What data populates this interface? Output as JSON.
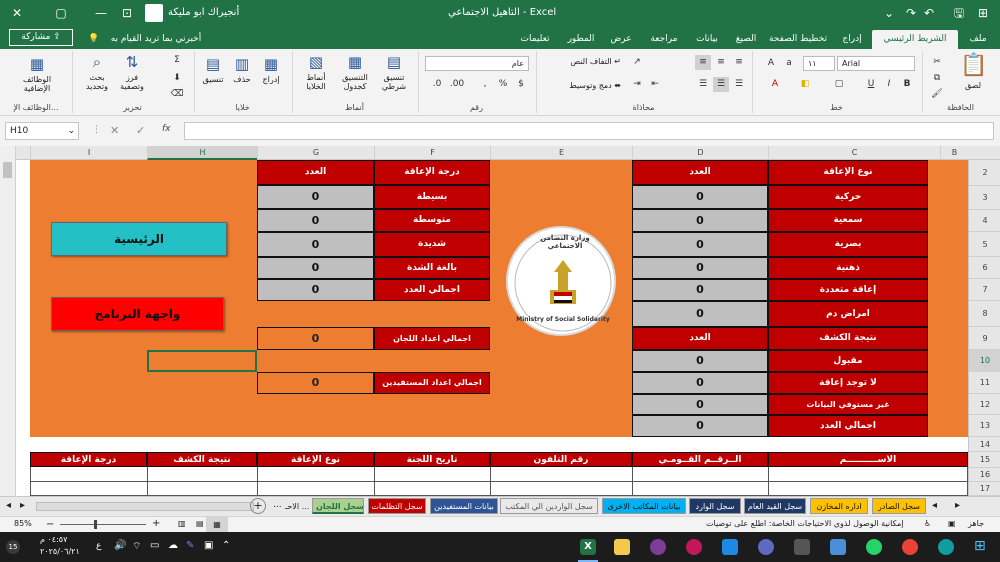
{
  "window": {
    "title": "التاهيل الاجتماعي  -  Excel",
    "user": "أنجيراك ابو مليكة",
    "search_hint": "أخبرني بما تريد القيام به"
  },
  "ribbon_tabs": [
    "ملف",
    "الشريط الرئيسي",
    "إدراج",
    "تخطيط الصفحة",
    "الصيغ",
    "بيانات",
    "مراجعة",
    "عرض",
    "المطور",
    "تعليمات"
  ],
  "share_label": "مشاركة",
  "ribbon": {
    "clipboard": {
      "label": "الحافظة",
      "paste": "لصق"
    },
    "font": {
      "label": "خط",
      "name": "Arial",
      "size": "١١"
    },
    "alignment": {
      "label": "محاذاة",
      "wrap": "التفاف النص",
      "merge": "دمج وتوسيط"
    },
    "number": {
      "label": "رقم",
      "format": "عام"
    },
    "styles": {
      "label": "أنماط",
      "conditional": "تنسيق شرطي",
      "table": "التنسيق كجدول",
      "cell": "أنماط الخلايا"
    },
    "cells": {
      "label": "خلايا",
      "insert": "إدراج",
      "delete": "حذف",
      "format": "تنسيق"
    },
    "editing": {
      "label": "تحرير",
      "sort": "فرز وتصفية",
      "find": "بحث وتحديد"
    },
    "addins": {
      "label": "الوظائف الإ...",
      "btn": "الوظائف الإضافية"
    }
  },
  "formula_bar": {
    "name_box": "H10",
    "fx": "fx"
  },
  "columns": [
    "A",
    "B",
    "C",
    "D",
    "E",
    "F",
    "G",
    "H",
    "I"
  ],
  "rows": [
    "1",
    "2",
    "3",
    "4",
    "5",
    "6",
    "7",
    "8",
    "9",
    "10",
    "11",
    "12",
    "13",
    "14",
    "15",
    "16",
    "17"
  ],
  "disability_type": {
    "header": "نوع الإعاقة",
    "count_header": "العدد",
    "items": [
      {
        "label": "حركية",
        "value": "0"
      },
      {
        "label": "سمعية",
        "value": "0"
      },
      {
        "label": "بصرية",
        "value": "0"
      },
      {
        "label": "ذهنية",
        "value": "0"
      },
      {
        "label": "إعاقة متعددة",
        "value": "0"
      },
      {
        "label": "امراض دم",
        "value": "0"
      }
    ]
  },
  "exam_result": {
    "header": "نتيجة الكشف",
    "count_header": "العدد",
    "items": [
      {
        "label": "مقبول",
        "value": "0"
      },
      {
        "label": "لا توجد إعاقة",
        "value": "0"
      },
      {
        "label": "غير مستوفي البيانات",
        "value": "0"
      },
      {
        "label": "اجمالي العدد",
        "value": "0"
      }
    ]
  },
  "degree": {
    "header": "درجة الإعاقة",
    "count_header": "العدد",
    "items": [
      {
        "label": "بسيطة",
        "value": "0"
      },
      {
        "label": "متوسطة",
        "value": "0"
      },
      {
        "label": "شديدة",
        "value": "0"
      },
      {
        "label": "بالغة الشدة",
        "value": "0"
      },
      {
        "label": "اجمالي العدد",
        "value": "0"
      }
    ]
  },
  "committees_total": {
    "label": "اجمالي اعداد اللجان",
    "value": "0"
  },
  "beneficiaries_total": {
    "label": "اجمالي اعداد المستفيدين",
    "value": "0"
  },
  "logo": {
    "arabic": "وزارة التضامن الاجتماعي",
    "english": "Ministry of Social Solidarity"
  },
  "buttons": {
    "main": "الرئيسية",
    "program": "واجهة البرنامج"
  },
  "bottom_headers": [
    "الاســــــــــم",
    "الــرقــم القــومـي",
    "رقم التلفون",
    "تاريخ اللجنة",
    "نوع الإعاقة",
    "نتيجة الكشف",
    "درجة الإعاقة"
  ],
  "sheet_tabs": [
    {
      "label": "سجل الصادر",
      "color": "#ffc000"
    },
    {
      "label": "اداره المخازن",
      "color": "#ffc000"
    },
    {
      "label": "سجل القيد العام",
      "color": "#1f3864"
    },
    {
      "label": "سجل الوارد",
      "color": "#1f3864"
    },
    {
      "label": "بيانات المكاتب الاخرى",
      "color": "#00b0f0"
    },
    {
      "label": "سجل الواردين الي المكتب",
      "color": "#d9d9d9"
    },
    {
      "label": "بيانات المستفيدين",
      "color": "#2f5496"
    },
    {
      "label": "سجل التظلمات",
      "color": "#c00000"
    },
    {
      "label": "سجل اللجان",
      "color": "#a9d08e"
    },
    {
      "label": "الاحـ ...",
      "color": "#e9e9e9"
    }
  ],
  "status": {
    "ready": "جاهز",
    "accessibility": "إمكانية الوصول لذوي الاحتياجات الخاصة: اطلع على توصيات",
    "zoom": "85%"
  },
  "taskbar": {
    "time": "٠٤:٥٧ م",
    "date": "٢٠٢٥/٠٦/٢١",
    "lang": "ع"
  }
}
